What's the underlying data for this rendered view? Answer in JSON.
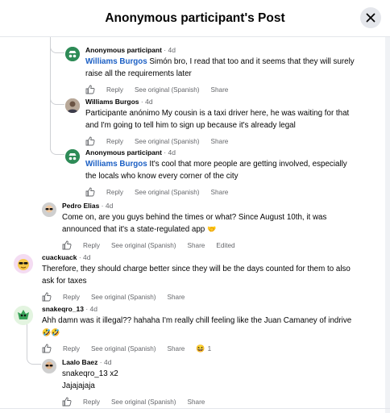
{
  "header": {
    "title": "Anonymous participant's Post"
  },
  "actions": {
    "reply": "Reply",
    "see_original": "See original (Spanish)",
    "share": "Share",
    "edited": "Edited"
  },
  "comments": [
    {
      "author": "Anonymous participant",
      "time": "4d",
      "mention": "Williams Burgos",
      "text_line1": " Simón bro, I read that too and it seems that they will surely",
      "text_line2": "raise all the requirements later",
      "avatar_icon": "anonymous-icon"
    },
    {
      "author": "Williams Burgos",
      "time": "4d",
      "text_line1": "Participante anónimo My cousin is a taxi driver here, he was waiting for that",
      "text_line2": "and I'm going to tell him to sign up because it's already legal",
      "avatar_icon": "profile-photo"
    },
    {
      "author": "Anonymous participant",
      "time": "4d",
      "mention": "Williams Burgos",
      "text_line1": " It's cool that more people are getting involved, especially",
      "text_line2": "the locals who know every corner of the city",
      "avatar_icon": "anonymous-icon"
    },
    {
      "author": "Pedro Elias",
      "time": "4d",
      "text_line1": "Come on, are you guys behind the times or what? Since August 10th, it was",
      "text_line2": "announced that it's a state-regulated app",
      "emoji": "🤝",
      "avatar_icon": "sunglasses-avatar"
    },
    {
      "author": "cuackuack",
      "time": "4d",
      "text_line1": "Therefore, they should charge better since they will be the days counted for them to also",
      "text_line2": "ask for taxes",
      "avatar_icon": "emoji-avatar"
    },
    {
      "author": "snakeqro_13",
      "time": "4d",
      "text_line1": "Ahh damn was it illegal?? hahaha I'm really chill feeling like the Juan Camaney of indrive",
      "text_line2": "🤣🤣",
      "reaction_count": "1",
      "reaction_emoji": "😆",
      "avatar_icon": "green-creature-avatar"
    },
    {
      "author": "Laalo Baez",
      "time": "4d",
      "text_line1": "snakeqro_13 x2",
      "text_line2": "Jajajajaja",
      "avatar_icon": "sunglasses-avatar"
    }
  ],
  "colors": {
    "link": "#1b5fc4",
    "secondary_text": "#65676b",
    "divider": "#ced0d4",
    "anon_avatar": "#2e8b57"
  }
}
